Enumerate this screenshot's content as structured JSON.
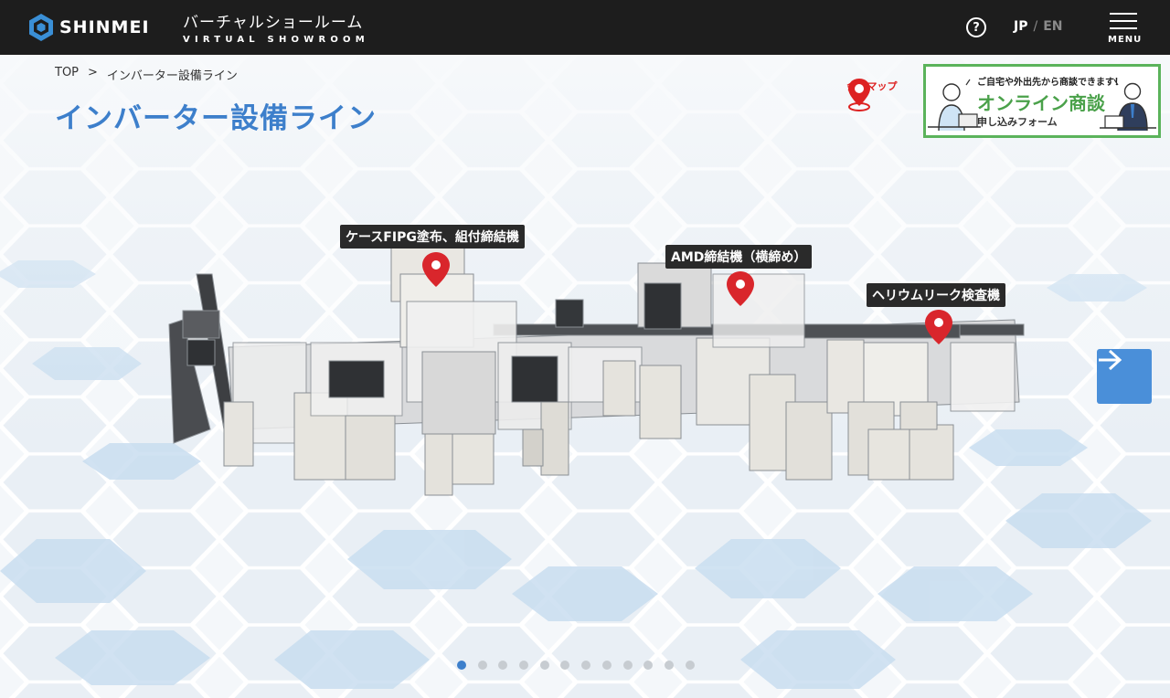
{
  "header": {
    "logo_text": "SHINMEI",
    "title_ja": "バーチャルショールーム",
    "title_en": "VIRTUAL SHOWROOM",
    "help_icon": "question-circle-icon",
    "lang_jp": "JP",
    "lang_sep": "/",
    "lang_en": "EN",
    "menu_label": "MENU"
  },
  "breadcrumb": {
    "home": "TOP",
    "separator": ">",
    "current": "インバーター設備ライン"
  },
  "page_title": "インバーター設備ライン",
  "map_link": {
    "label": "会場マップ",
    "icon": "map-pin-icon"
  },
  "banner": {
    "top_text": "ご自宅や外出先から商談できます！",
    "main_text": "オンライン商談",
    "sub_text": "申し込みフォーム"
  },
  "markers": [
    {
      "label": "ケースFIPG塗布、組付締結機"
    },
    {
      "label": "AMD締結機（横締め）"
    },
    {
      "label": "ヘリウムリーク検査機"
    }
  ],
  "next_button": {
    "icon": "arrow-right-icon"
  },
  "pagination": {
    "total": 12,
    "active": 1
  },
  "colors": {
    "header_bg": "#1d1d1d",
    "title_blue": "#3d7fcb",
    "marker_red": "#d9262c",
    "banner_green": "#5bb35b",
    "next_button_blue": "#4a8fd9"
  }
}
